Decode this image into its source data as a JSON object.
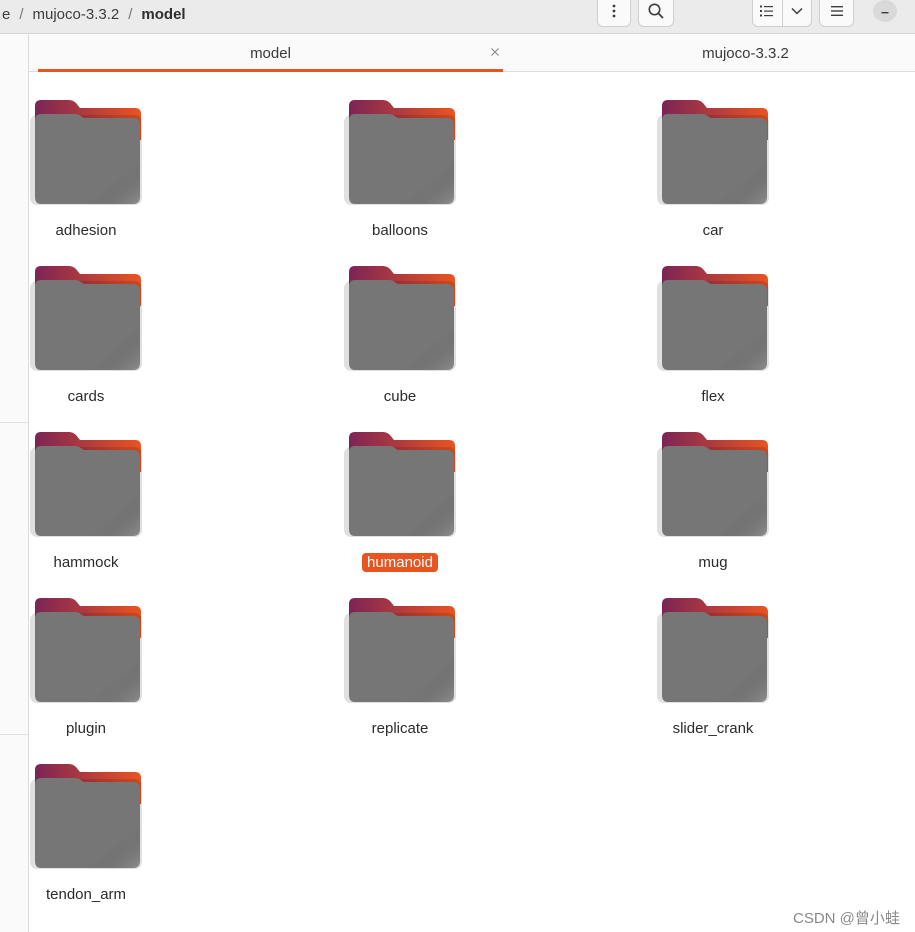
{
  "breadcrumb": {
    "items": [
      "e",
      "mujoco-3.3.2",
      "model"
    ],
    "separator": "/"
  },
  "toolbar": {
    "menu_icon": "vertical-dots-icon",
    "search_icon": "search-icon",
    "view_list_icon": "list-view-icon",
    "view_options_icon": "chevron-down-icon",
    "main_menu_icon": "hamburger-icon",
    "minimize_icon": "minimize-icon"
  },
  "tabs": [
    {
      "label": "model",
      "active": true,
      "close_icon": "close-icon"
    },
    {
      "label": "mujoco-3.3.2",
      "active": false
    }
  ],
  "files": [
    {
      "name": "adhesion",
      "type": "folder",
      "selected": false
    },
    {
      "name": "balloons",
      "type": "folder",
      "selected": false
    },
    {
      "name": "car",
      "type": "folder",
      "selected": false
    },
    {
      "name": "cards",
      "type": "folder",
      "selected": false
    },
    {
      "name": "cube",
      "type": "folder",
      "selected": false
    },
    {
      "name": "flex",
      "type": "folder",
      "selected": false
    },
    {
      "name": "hammock",
      "type": "folder",
      "selected": false
    },
    {
      "name": "humanoid",
      "type": "folder",
      "selected": true
    },
    {
      "name": "mug",
      "type": "folder",
      "selected": false
    },
    {
      "name": "plugin",
      "type": "folder",
      "selected": false
    },
    {
      "name": "replicate",
      "type": "folder",
      "selected": false
    },
    {
      "name": "slider_crank",
      "type": "folder",
      "selected": false
    },
    {
      "name": "tendon_arm",
      "type": "folder",
      "selected": false
    }
  ],
  "colors": {
    "accent": "#e95420",
    "folder_body": "#767676",
    "folder_tab_start": "#7c2456",
    "folder_tab_end": "#e95420"
  },
  "watermark": "CSDN @曾小蛙"
}
